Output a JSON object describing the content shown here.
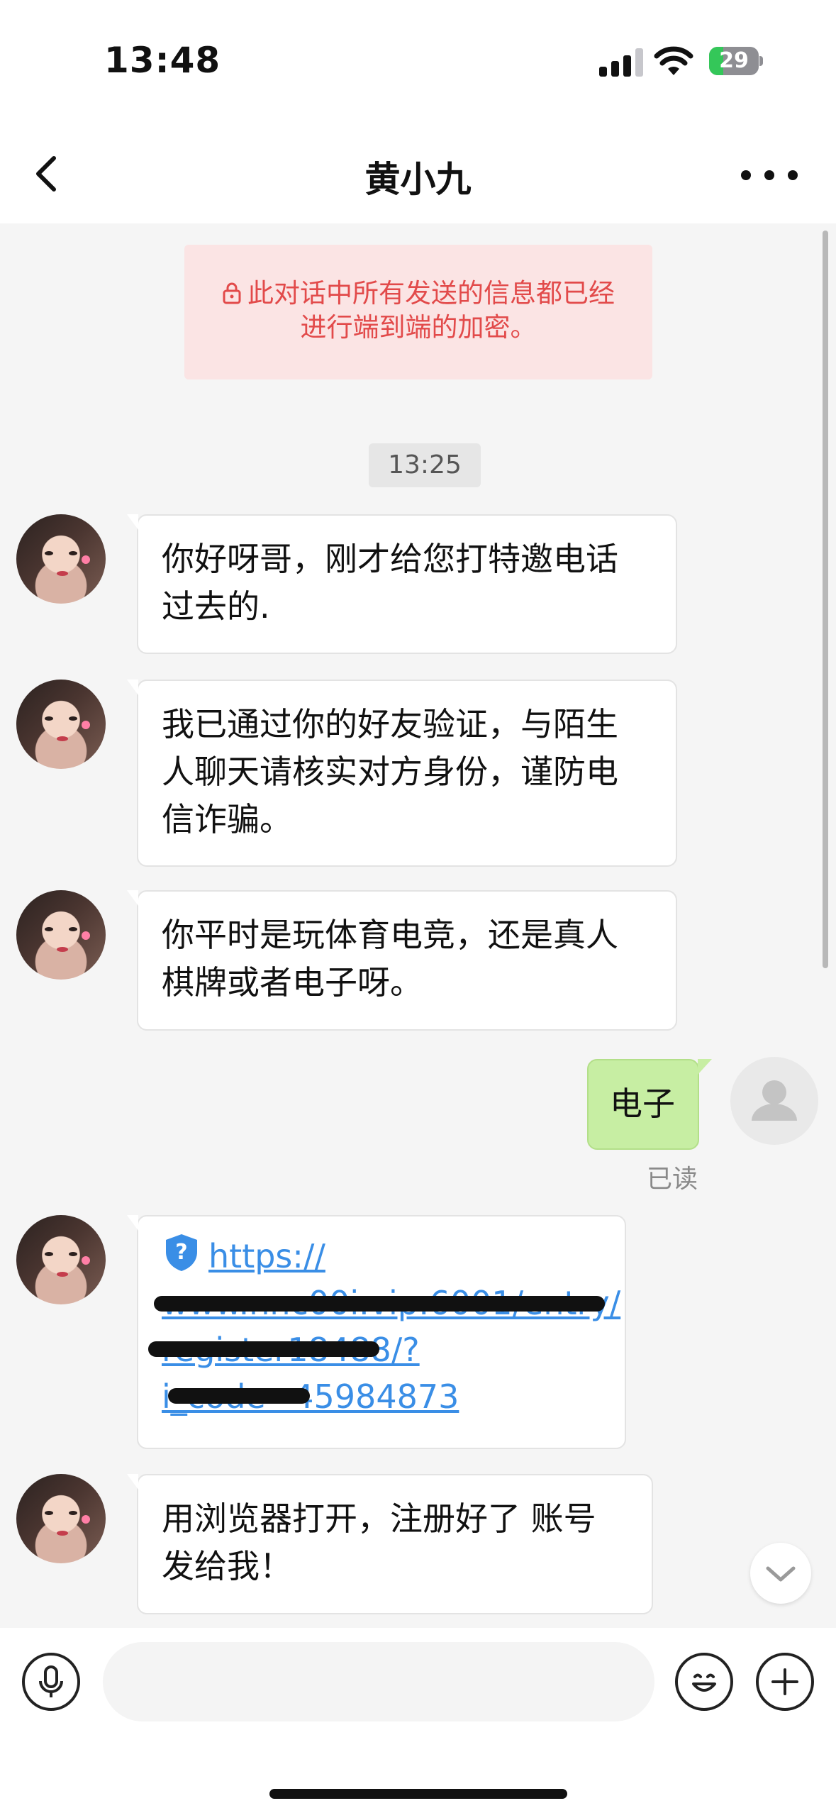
{
  "status_bar": {
    "time": "13:48",
    "battery": "29",
    "battery_level": 0.29
  },
  "nav": {
    "title": "黄小九"
  },
  "encryption_notice": {
    "line1": "此对话中所有发送的信息都已经",
    "line2": "进行端到端的加密。"
  },
  "timestamp": "13:25",
  "messages": [
    {
      "side": "left",
      "lines": [
        "你好呀哥，刚才给您打特邀电话",
        "过去的."
      ]
    },
    {
      "side": "left",
      "lines": [
        "我已通过你的好友验证，与陌生",
        "人聊天请核实对方身份，谨防电",
        "信诈骗。"
      ]
    },
    {
      "side": "left",
      "lines": [
        "你平时是玩体育电竞，还是真人",
        "棋牌或者电子呀。"
      ]
    },
    {
      "side": "right",
      "lines": [
        "电子"
      ],
      "status": "已读"
    },
    {
      "side": "left",
      "type": "link",
      "lines": [
        "https://",
        "www.nnc00i.vip:6001/entry/",
        "register18488/?",
        "i_code=45984873"
      ]
    },
    {
      "side": "left",
      "lines": [
        "用浏览器打开，注册好了 账号",
        "发给我！"
      ]
    }
  ],
  "input": {
    "placeholder": ""
  },
  "icons": {
    "back": "chevron-left-icon",
    "more": "more-dots-icon",
    "lock": "lock-icon",
    "link": "shield-question-icon",
    "mic": "microphone-icon",
    "emoji": "emoji-icon",
    "plus": "plus-icon",
    "scroll_down": "chevron-down-icon"
  },
  "colors": {
    "accent_link": "#3a8ee6",
    "self_bubble": "#c7eea3",
    "notice_bg": "#fbe4e4",
    "notice_text": "#e24a4a",
    "battery": "#34c759"
  }
}
